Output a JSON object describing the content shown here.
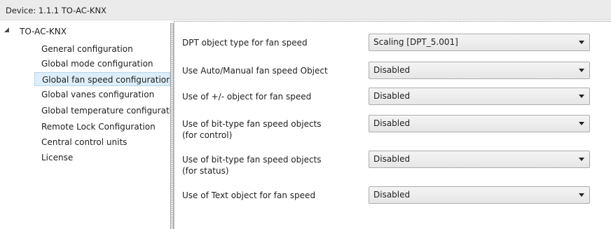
{
  "header": {
    "title": "Device: 1.1.1  TO-AC-KNX"
  },
  "tree": {
    "root": "TO-AC-KNX",
    "items": [
      {
        "label": "General configuration"
      },
      {
        "label": "Global mode configuration"
      },
      {
        "label": "Global fan speed configuration",
        "selected": true
      },
      {
        "label": "Global vanes configuration"
      },
      {
        "label": "Global temperature configurati"
      },
      {
        "label": "Remote Lock Configuration"
      },
      {
        "label": "Central control units"
      },
      {
        "label": "License"
      }
    ]
  },
  "params": [
    {
      "label": "DPT object type for fan speed",
      "value": "Scaling [DPT_5.001]"
    },
    {
      "label": "Use Auto/Manual fan speed Object",
      "value": "Disabled"
    },
    {
      "label": "Use of +/- object for fan speed",
      "value": "Disabled"
    },
    {
      "label_line1": "Use of bit-type fan speed objects",
      "label_line2": "(for control)",
      "value": "Disabled"
    },
    {
      "label_line1": "Use of bit-type fan speed objects",
      "label_line2": "(for status)",
      "value": "Disabled"
    },
    {
      "label": "Use of Text object for fan speed",
      "value": "Disabled"
    }
  ],
  "icons": {
    "expand": "triangle-down-right-icon",
    "dropdown": "chevron-down-icon"
  }
}
